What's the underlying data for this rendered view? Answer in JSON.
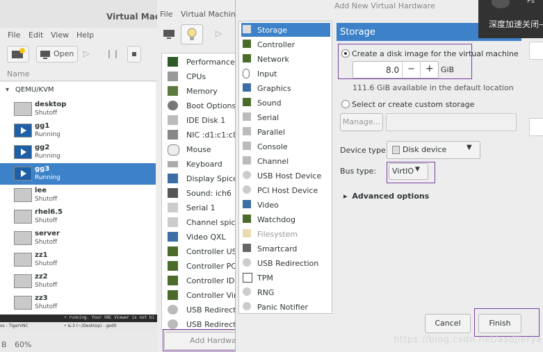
{
  "win1": {
    "title": "Virtual Machi",
    "menu": [
      "File",
      "Edit",
      "View",
      "Help"
    ],
    "open_label": "Open",
    "col_header": "Name",
    "group": "QEMU/KVM",
    "vms": [
      {
        "name": "desktop",
        "status": "Shutoff"
      },
      {
        "name": "gg1",
        "status": "Running"
      },
      {
        "name": "gg2",
        "status": "Running"
      },
      {
        "name": "gg3",
        "status": "Running"
      },
      {
        "name": "lee",
        "status": "Shutoff"
      },
      {
        "name": "rhel6.5",
        "status": "Shutoff"
      },
      {
        "name": "server",
        "status": "Shutoff"
      },
      {
        "name": "zz1",
        "status": "Shutoff"
      },
      {
        "name": "zz2",
        "status": "Shutoff"
      },
      {
        "name": "zz3",
        "status": "Shutoff"
      }
    ],
    "terminal_text": "• running. Your VNC Viewer is not bi",
    "taskbar": [
      "os - TigerVNC",
      "• &:3 (~/Desktop) - gedit"
    ],
    "status": [
      "B",
      "60%"
    ]
  },
  "win2": {
    "menu": [
      "File",
      "Virtual Machine"
    ],
    "hardware": [
      "Performance",
      "CPUs",
      "Memory",
      "Boot Options",
      "IDE Disk 1",
      "NIC :d1:c1:c8",
      "Mouse",
      "Keyboard",
      "Display Spice",
      "Sound: ich6",
      "Serial 1",
      "Channel spice",
      "Video QXL",
      "Controller USB",
      "Controller PCI",
      "Controller IDE",
      "Controller VirtIO",
      "USB Redirector",
      "USB Redirector"
    ],
    "add_hardware": "Add Hardware"
  },
  "dialog": {
    "title": "Add New Virtual Hardware",
    "categories": [
      "Storage",
      "Controller",
      "Network",
      "Input",
      "Graphics",
      "Sound",
      "Serial",
      "Parallel",
      "Console",
      "Channel",
      "USB Host Device",
      "PCI Host Device",
      "Video",
      "Watchdog",
      "Filesystem",
      "Smartcard",
      "USB Redirection",
      "TPM",
      "RNG",
      "Panic Notifier"
    ],
    "header": "Storage",
    "create_label": "Create a disk image for the virtual machine",
    "size_value": "8.0",
    "size_unit": "GiB",
    "minus": "−",
    "plus": "+",
    "available": "111.6 GiB available in the default location",
    "custom_label": "Select or create custom storage",
    "manage": "Manage...",
    "device_type_label": "Device type:",
    "device_type_value": "Disk device",
    "bus_type_label": "Bus type:",
    "bus_type_value": "VirtIO",
    "advanced": "Advanced options",
    "cancel": "Cancel",
    "finish": "Finish"
  },
  "popup": {
    "text": "深度加速关闭—",
    "top": "Ps"
  },
  "watermark": "https://blog.csdn.net/asdjieryai",
  "colors": {
    "selection": "#3d82c8",
    "highlight_box": "#7a3ea0"
  }
}
